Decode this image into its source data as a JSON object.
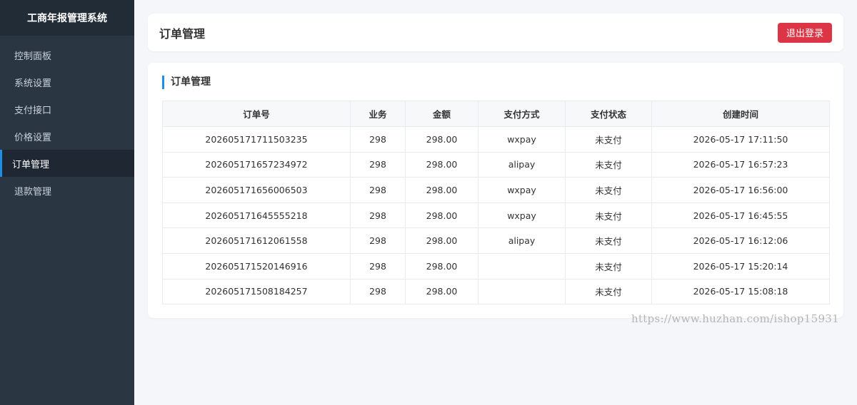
{
  "sidebar": {
    "brand": "工商年报管理系统",
    "items": [
      {
        "label": "控制面板"
      },
      {
        "label": "系统设置"
      },
      {
        "label": "支付接口"
      },
      {
        "label": "价格设置"
      },
      {
        "label": "订单管理"
      },
      {
        "label": "退款管理"
      }
    ]
  },
  "header": {
    "title": "订单管理",
    "logout_label": "退出登录"
  },
  "card": {
    "title": "订单管理",
    "columns": [
      "订单号",
      "业务",
      "金额",
      "支付方式",
      "支付状态",
      "创建时间"
    ],
    "rows": [
      [
        "202605171711503235",
        "298",
        "298.00",
        "wxpay",
        "未支付",
        "2026-05-17 17:11:50"
      ],
      [
        "202605171657234972",
        "298",
        "298.00",
        "alipay",
        "未支付",
        "2026-05-17 16:57:23"
      ],
      [
        "202605171656006503",
        "298",
        "298.00",
        "wxpay",
        "未支付",
        "2026-05-17 16:56:00"
      ],
      [
        "202605171645555218",
        "298",
        "298.00",
        "wxpay",
        "未支付",
        "2026-05-17 16:45:55"
      ],
      [
        "202605171612061558",
        "298",
        "298.00",
        "alipay",
        "未支付",
        "2026-05-17 16:12:06"
      ],
      [
        "202605171520146916",
        "298",
        "298.00",
        "",
        "未支付",
        "2026-05-17 15:20:14"
      ],
      [
        "202605171508184257",
        "298",
        "298.00",
        "",
        "未支付",
        "2026-05-17 15:08:18"
      ]
    ]
  },
  "watermark": "https://www.huzhan.com/ishop15931",
  "colors": {
    "sidebar_bg": "#2b3643",
    "accent": "#1f8fe6",
    "danger": "#dc3545"
  }
}
